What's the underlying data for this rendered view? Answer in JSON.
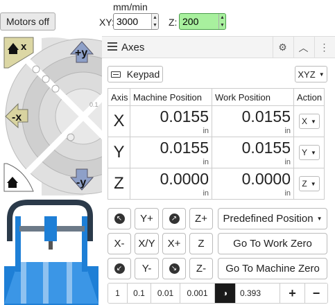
{
  "topbar": {
    "motors_label": "Motors off",
    "feed_units": "mm/min",
    "xy_label": "XY:",
    "xy_value": "3000",
    "z_label": "Z:",
    "z_value": "200"
  },
  "jog": {
    "home_x_label": "x",
    "plus_y_label": "+y",
    "minus_x_label": "-x",
    "minus_y_label": "-y",
    "small_step_label": "0.1"
  },
  "panel": {
    "title": "Axes",
    "keypad_label": "Keypad",
    "xyz_label": "XYZ",
    "columns": [
      "Axis",
      "Machine Position",
      "Work Position",
      "Action"
    ],
    "rows": [
      {
        "axis": "X",
        "machine": "0.0155",
        "machine_unit": "in",
        "work": "0.0155",
        "work_unit": "in",
        "action": "X"
      },
      {
        "axis": "Y",
        "machine": "0.0155",
        "machine_unit": "in",
        "work": "0.0155",
        "work_unit": "in",
        "action": "Y"
      },
      {
        "axis": "Z",
        "machine": "0.0000",
        "machine_unit": "in",
        "work": "0.0000",
        "work_unit": "in",
        "action": "Z"
      }
    ],
    "jog_buttons": {
      "y_plus": "Y+",
      "z_plus": "Z+",
      "x_minus": "X-",
      "xy": "X/Y",
      "x_plus": "X+",
      "z": "Z",
      "y_minus": "Y-",
      "z_minus": "Z-"
    },
    "predefined_label": "Predefined Position",
    "go_work_zero_label": "Go To Work Zero",
    "go_machine_zero_label": "Go To Machine Zero",
    "steps": [
      "1",
      "0.1",
      "0.01",
      "0.001"
    ],
    "step_value": "0.393",
    "plus_label": "+",
    "minus_label": "−"
  },
  "colors": {
    "z_feed_bg": "#a8f09e",
    "jog_arrow": "#8ea0c8",
    "jog_gray": "#c9c9c9",
    "machine_blue": "#1e7fd6"
  }
}
